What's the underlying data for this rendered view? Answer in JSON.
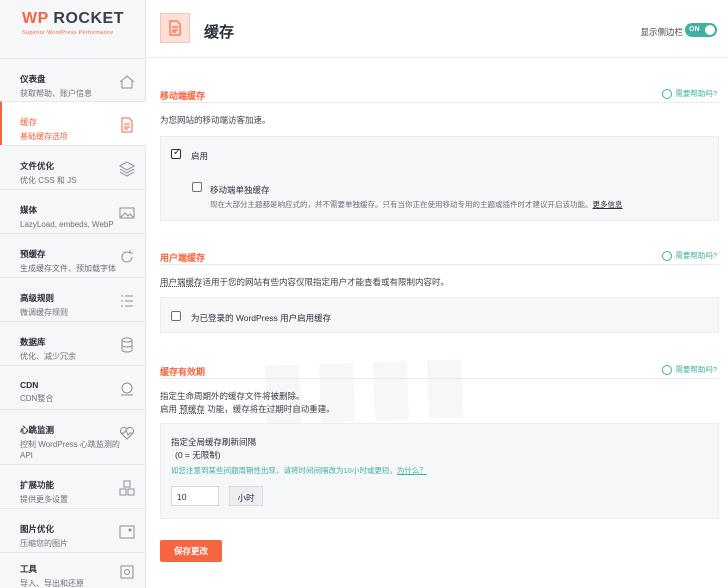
{
  "logo": {
    "main_wp": "WP",
    "main_rest": " ROCKET",
    "tagline": "Superior WordPress Performance"
  },
  "sidebar": {
    "items": [
      {
        "title": "仪表盘",
        "desc": "获取帮助、账户信息",
        "icon": "home-icon"
      },
      {
        "title": "缓存",
        "desc": "基础缓存选项",
        "icon": "file-icon",
        "active": true
      },
      {
        "title": "文件优化",
        "desc": "优化 CSS 和 JS",
        "icon": "layers-icon"
      },
      {
        "title": "媒体",
        "desc": "LazyLoad, embeds, WebP",
        "icon": "image-icon"
      },
      {
        "title": "预缓存",
        "desc": "生成缓存文件、预加载字体",
        "icon": "refresh-icon"
      },
      {
        "title": "高级规则",
        "desc": "微调缓存规则",
        "icon": "list-icon"
      },
      {
        "title": "数据库",
        "desc": "优化、减少冗余",
        "icon": "database-icon"
      },
      {
        "title": "CDN",
        "desc": "CDN整合",
        "icon": "cdn-icon"
      },
      {
        "title": "心跳监测",
        "desc": "控制 WordPress 心跳监测的 API",
        "icon": "heart-icon"
      },
      {
        "title": "扩展功能",
        "desc": "提供更多设置",
        "icon": "addons-icon"
      },
      {
        "title": "图片优化",
        "desc": "压缩您的图片",
        "icon": "image-optimize-icon"
      },
      {
        "title": "工具",
        "desc": "导入、导出和还原",
        "icon": "tools-icon"
      }
    ]
  },
  "header": {
    "title": "缓存",
    "toggle_label": "显示侧边栏",
    "toggle_state": "ON"
  },
  "help_label": "需要帮助吗?",
  "mobile": {
    "title": "移动端缓存",
    "desc": "为您网站的移动端访客加速。",
    "enable_label": "启用",
    "separate_label": "移动端单独缓存",
    "separate_desc": "现在大部分主题都是响应式的，并不需要单独缓存。只有当你正在使用移动专用的主题或插件时才建议开启该功能。",
    "more_info": "更多信息"
  },
  "user": {
    "title": "用户端缓存",
    "desc_link": "用户端缓存",
    "desc_rest": "适用于您的网站有些内容仅限指定用户才能查看或有限制内容时。",
    "option_label": "为已登录的 WordPress 用户启用缓存"
  },
  "lifespan": {
    "title": "缓存有效期",
    "desc1": "指定生命周期外的缓存文件将被删除。",
    "desc2_pre": "启用 ",
    "desc2_link": "预缓存",
    "desc2_post": " 功能，缓存将在过期时自动重建。",
    "field_title": "指定全局缓存刷新间隔",
    "field_sub": "(0 = 无限制)",
    "hint": "如您注意到某些间题周期性出现，请将时间间隔改为10小时或更短。",
    "hint_link": "为什么？",
    "value": "10",
    "unit": "小时"
  },
  "save_label": "保存更改",
  "colors": {
    "accent": "#f56640",
    "green": "#40b1a0"
  }
}
